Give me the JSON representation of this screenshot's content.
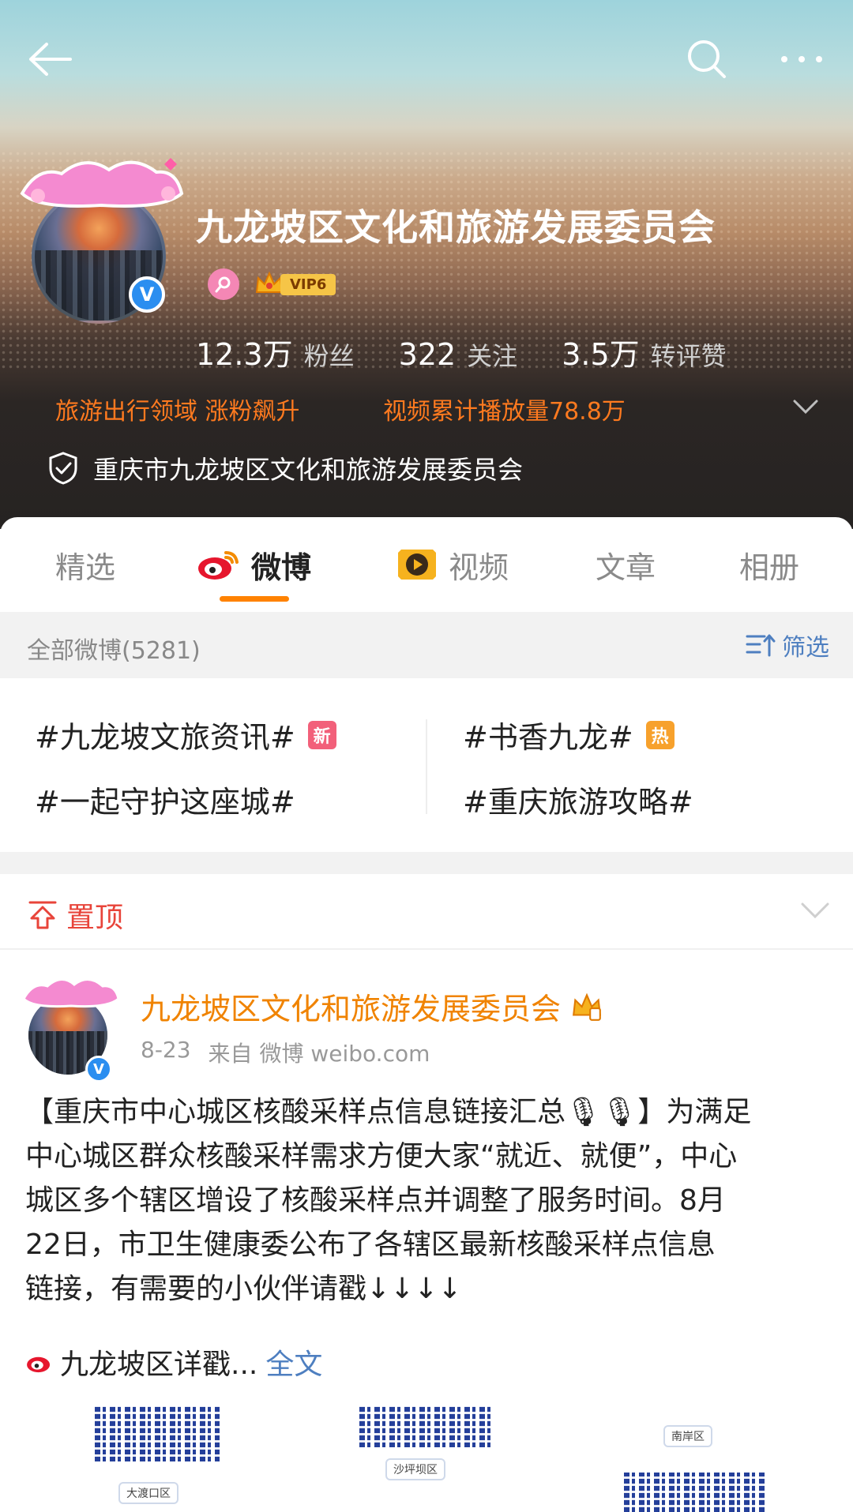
{
  "header": {
    "profile_name": "九龙坡区文化和旅游发展委员会",
    "vip_label": "VIP6",
    "stats": [
      {
        "num": "12.3万",
        "label": "粉丝"
      },
      {
        "num": "322",
        "label": "关注"
      },
      {
        "num": "3.5万",
        "label": "转评赞"
      }
    ],
    "honors": [
      "旅游出行领域 涨粉飙升",
      "视频累计播放量78.8万"
    ],
    "verification": "重庆市九龙坡区文化和旅游发展委员会"
  },
  "tabs": [
    "精选",
    "微博",
    "视频",
    "文章",
    "相册"
  ],
  "active_tab": "微博",
  "filter": {
    "count_label": "全部微博(5281)",
    "filter_label": "筛选"
  },
  "topics": [
    {
      "text": "#九龙坡文旅资讯#",
      "tag": "新"
    },
    {
      "text": "#书香九龙#",
      "tag": "热"
    },
    {
      "text": "#一起守护这座城#",
      "tag": ""
    },
    {
      "text": "#重庆旅游攻略#",
      "tag": ""
    }
  ],
  "pinned_label": "置顶",
  "post": {
    "author": "九龙坡区文化和旅游发展委员会",
    "date": "8-23",
    "source": "来自 微博 weibo.com",
    "lines": [
      "【重庆市中心城区核酸采样点信息链接汇总🎙🎙】为满足",
      "中心城区群众核酸采样需求方便大家“就近、就便”，中心",
      "城区多个辖区增设了核酸采样点并调整了服务时间。8月",
      "22日，市卫生健康委公布了各辖区最新核酸采样点信息",
      "链接，有需要的小伙伴请戳↓↓↓↓"
    ],
    "link_text": "九龙坡区详戳...",
    "full_text_label": "全文",
    "qr_labels": [
      "大渡口区",
      "沙坪坝区",
      "南岸区"
    ]
  },
  "colors": {
    "accent_orange": "#ff8200",
    "link_blue": "#4e7fc0",
    "pinned_red": "#e8443a",
    "verified_blue": "#2b8ef0"
  }
}
